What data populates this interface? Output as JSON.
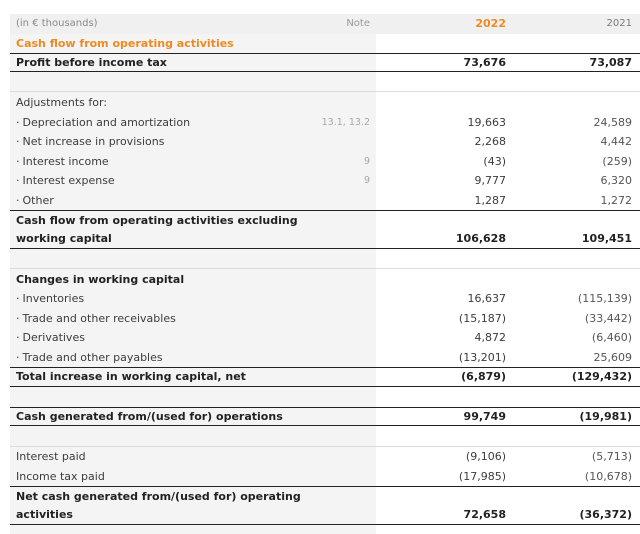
{
  "header": {
    "unit_label": "(in € thousands)",
    "note_label": "Note",
    "col_2022": "2022",
    "col_2021": "2021"
  },
  "rows": [
    {
      "label": "Cash flow from operating activities",
      "note": "",
      "v22": "",
      "v21": ""
    },
    {
      "label": "Profit before income tax",
      "note": "",
      "v22": "73,676",
      "v21": "73,087"
    },
    {
      "label": "",
      "note": "",
      "v22": "",
      "v21": ""
    },
    {
      "label": "Adjustments for:",
      "note": "",
      "v22": "",
      "v21": ""
    },
    {
      "label": "Depreciation and amortization",
      "note": "13.1, 13.2",
      "v22": "19,663",
      "v21": "24,589"
    },
    {
      "label": "Net increase in provisions",
      "note": "",
      "v22": "2,268",
      "v21": "4,442"
    },
    {
      "label": "Interest income",
      "note": "9",
      "v22": "(43)",
      "v21": "(259)"
    },
    {
      "label": "Interest expense",
      "note": "9",
      "v22": "9,777",
      "v21": "6,320"
    },
    {
      "label": "Other",
      "note": "",
      "v22": "1,287",
      "v21": "1,272"
    },
    {
      "label": "Cash flow from operating activities excluding",
      "note": "",
      "v22": "",
      "v21": ""
    },
    {
      "label": "working capital",
      "note": "",
      "v22": "106,628",
      "v21": "109,451"
    },
    {
      "label": "",
      "note": "",
      "v22": "",
      "v21": ""
    },
    {
      "label": "Changes in working capital",
      "note": "",
      "v22": "",
      "v21": ""
    },
    {
      "label": "Inventories",
      "note": "",
      "v22": "16,637",
      "v21": "(115,139)"
    },
    {
      "label": "Trade and other receivables",
      "note": "",
      "v22": "(15,187)",
      "v21": "(33,442)"
    },
    {
      "label": "Derivatives",
      "note": "",
      "v22": "4,872",
      "v21": "(6,460)"
    },
    {
      "label": "Trade and other payables",
      "note": "",
      "v22": "(13,201)",
      "v21": "25,609"
    },
    {
      "label": "Total increase in working capital, net",
      "note": "",
      "v22": "(6,879)",
      "v21": "(129,432)"
    },
    {
      "label": "",
      "note": "",
      "v22": "",
      "v21": ""
    },
    {
      "label": "Cash generated from/(used for) operations",
      "note": "",
      "v22": "99,749",
      "v21": "(19,981)"
    },
    {
      "label": "",
      "note": "",
      "v22": "",
      "v21": ""
    },
    {
      "label": "Interest paid",
      "note": "",
      "v22": "(9,106)",
      "v21": "(5,713)"
    },
    {
      "label": "Income tax paid",
      "note": "",
      "v22": "(17,985)",
      "v21": "(10,678)"
    },
    {
      "label": "Net cash generated from/(used for) operating",
      "note": "",
      "v22": "",
      "v21": ""
    },
    {
      "label": "activities",
      "note": "",
      "v22": "72,658",
      "v21": "(36,372)"
    }
  ]
}
